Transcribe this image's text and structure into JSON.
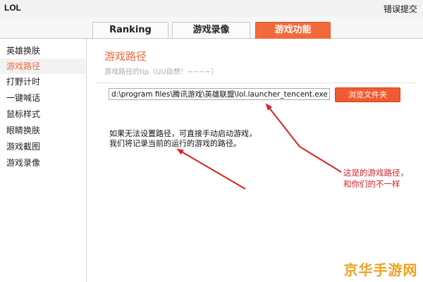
{
  "window": {
    "title": "LOL",
    "report_link": "错误提交"
  },
  "tabs": [
    {
      "label": "Ranking",
      "active": false
    },
    {
      "label": "游戏录像",
      "active": false
    },
    {
      "label": "游戏功能",
      "active": true
    }
  ],
  "sidebar": {
    "items": [
      {
        "label": "英雄换肤",
        "active": false
      },
      {
        "label": "游戏路径",
        "active": true
      },
      {
        "label": "打野计时",
        "active": false
      },
      {
        "label": "一键喊话",
        "active": false
      },
      {
        "label": "鼠标样式",
        "active": false
      },
      {
        "label": "眼睛换肤",
        "active": false
      },
      {
        "label": "游戏截图",
        "active": false
      },
      {
        "label": "游戏录像",
        "active": false
      }
    ]
  },
  "main": {
    "section_title": "游戏路径",
    "tip": "游戏路径的tip（UU自想！~~~~）",
    "path_value": "d:\\program files\\腾讯游戏\\英雄联盟\\lol.launcher_tencent.exe",
    "browse_label": "浏览文件夹",
    "note_lines": [
      "如果无法设置路径，可直接手动启动游戏，",
      "我们将记录当前的运行的游戏的路径。"
    ]
  },
  "annotation": {
    "lines": [
      "这是的游戏路径，",
      "和你们的不一样"
    ]
  },
  "watermark": "京华手游网",
  "colors": {
    "accent": "#f26a3b",
    "button": "#f05a32",
    "annotation": "#d81f1f",
    "watermark": "#f0a21f"
  }
}
